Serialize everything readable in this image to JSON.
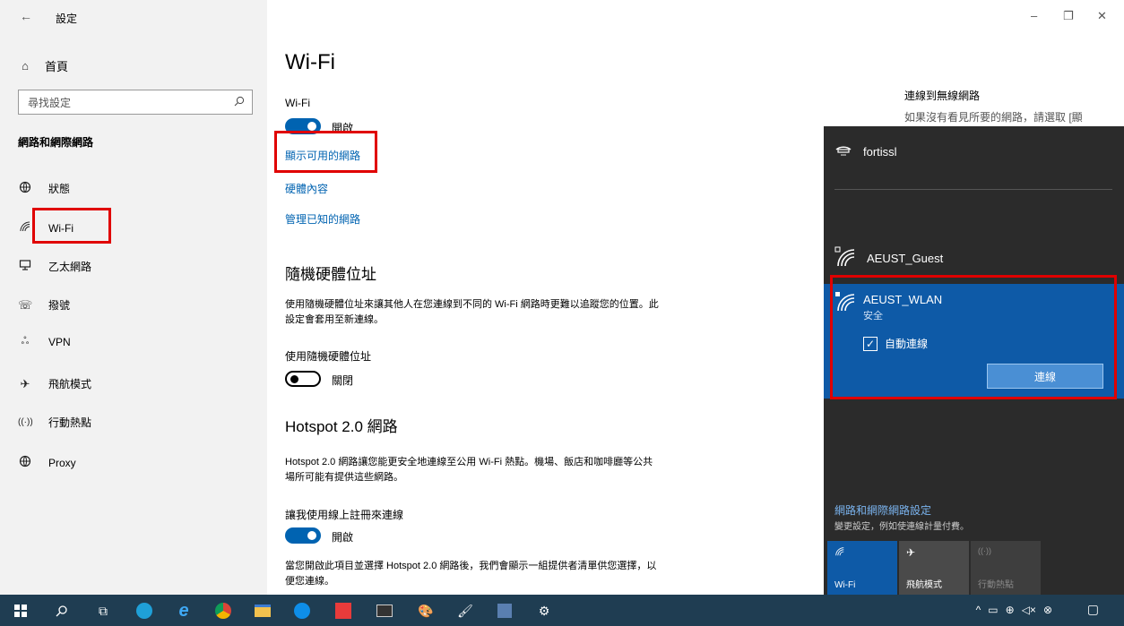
{
  "window": {
    "title": "設定",
    "back_icon": "←",
    "minimize": "–",
    "restore": "❐",
    "close": "✕"
  },
  "sidebar": {
    "home_label": "首頁",
    "search_placeholder": "尋找設定",
    "section_title": "網路和網際網路",
    "items": [
      {
        "label": "狀態",
        "icon": "globe-icon"
      },
      {
        "label": "Wi-Fi",
        "icon": "wifi-icon"
      },
      {
        "label": "乙太網路",
        "icon": "ethernet-icon"
      },
      {
        "label": "撥號",
        "icon": "dialup-icon"
      },
      {
        "label": "VPN",
        "icon": "vpn-icon"
      },
      {
        "label": "飛航模式",
        "icon": "airplane-icon"
      },
      {
        "label": "行動熱點",
        "icon": "hotspot-icon"
      },
      {
        "label": "Proxy",
        "icon": "proxy-icon"
      }
    ]
  },
  "main": {
    "title": "Wi-Fi",
    "wifi_label": "Wi-Fi",
    "wifi_state": "開啟",
    "link_show_networks": "顯示可用的網路",
    "link_hardware": "硬體內容",
    "link_manage": "管理已知的網路",
    "random_hw_title": "隨機硬體位址",
    "random_hw_desc": "使用隨機硬體位址來讓其他人在您連線到不同的 Wi-Fi 網路時更難以追蹤您的位置。此設定會套用至新連線。",
    "random_hw_label": "使用隨機硬體位址",
    "random_hw_state": "關閉",
    "hotspot_title": "Hotspot 2.0 網路",
    "hotspot_desc": "Hotspot 2.0 網路讓您能更安全地連線至公用 Wi-Fi 熱點。機場、飯店和咖啡廳等公共場所可能有提供這些網路。",
    "online_signup_label": "讓我使用線上註冊來連線",
    "online_signup_state": "開啟",
    "hotspot_footer": "當您開啟此項目並選擇 Hotspot 2.0 網路後，我們會顯示一組提供者清單供您選擇，以便您連線。",
    "right_title": "連線到無線網路",
    "right_text": "如果沒有看見所要的網路，請選取 [顯"
  },
  "flyout": {
    "network_1": "fortissl",
    "network_2": "AEUST_Guest",
    "selected_network": "AEUST_WLAN",
    "selected_status": "安全",
    "auto_connect_label": "自動連線",
    "connect_button": "連線",
    "settings_link": "網路和網際網路設定",
    "settings_sub": "變更設定，例如使連線計量付費。",
    "tiles": [
      {
        "label": "Wi-Fi",
        "active": true
      },
      {
        "label": "飛航模式",
        "active": false
      },
      {
        "label": "行動熱點",
        "active": false
      }
    ]
  },
  "colors": {
    "accent": "#0063b1",
    "flyout_bg": "#2b2b2b",
    "selected_bg": "#0e5aa7",
    "highlight_red": "#e00000",
    "taskbar_bg": "#1f3d52"
  }
}
